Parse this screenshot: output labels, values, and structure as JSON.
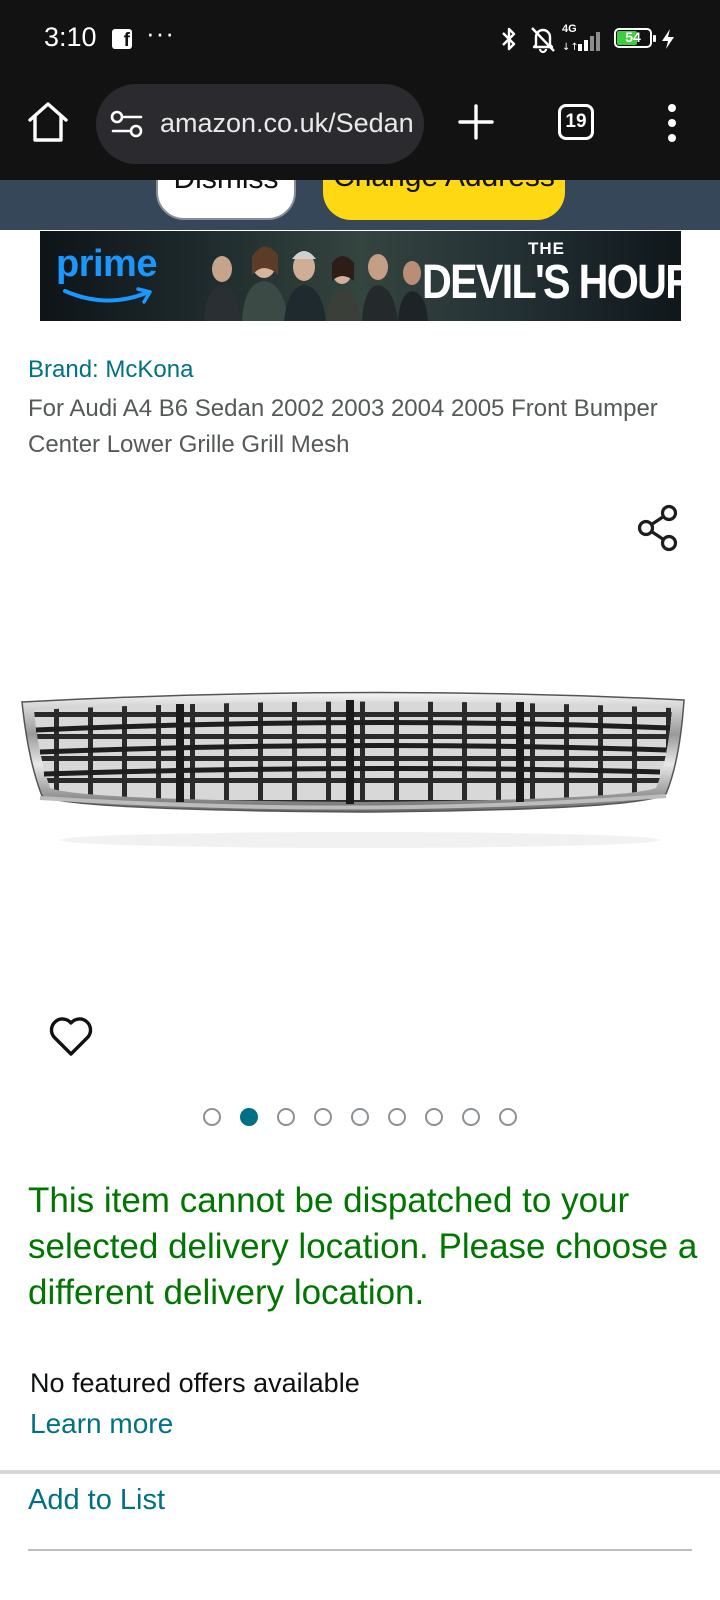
{
  "status_bar": {
    "time": "3:10",
    "notification_dots": "···",
    "network": "4G",
    "battery": "54",
    "icons": [
      "facebook-icon",
      "bluetooth-icon",
      "bell-off-icon",
      "signal-icon",
      "battery-icon",
      "charging-icon"
    ]
  },
  "browser": {
    "url": "amazon.co.uk/Sedan",
    "tab_count": "19",
    "icons": [
      "home-icon",
      "tune-icon",
      "plus-icon",
      "tabs-icon",
      "more-vert-icon"
    ]
  },
  "location_strip": {
    "dismiss_label": "Dismiss",
    "change_address_label": "Change Address"
  },
  "ad_banner": {
    "logo_text": "prime",
    "show_prefix": "THE",
    "show_title": "DEVIL'S HOUR"
  },
  "product": {
    "brand": "Brand: McKona",
    "title": "For Audi A4 B6 Sedan 2002 2003 2004 2005 Front Bumper Center Lower Grille Grill Mesh",
    "image_count": 9,
    "active_image_index": 1
  },
  "availability": {
    "message": "This item cannot be dispatched to your selected delivery location. Please choose a different delivery location.",
    "no_offers": "No featured offers available",
    "learn_more": "Learn more"
  },
  "actions": {
    "add_to_list": "Add to List"
  },
  "colors": {
    "status_bar_bg": "#121212",
    "strip_bg": "#37475a",
    "link": "#007185",
    "availability_green": "#007600",
    "change_button": "#ffd814",
    "prime_blue": "#1a98ff"
  }
}
